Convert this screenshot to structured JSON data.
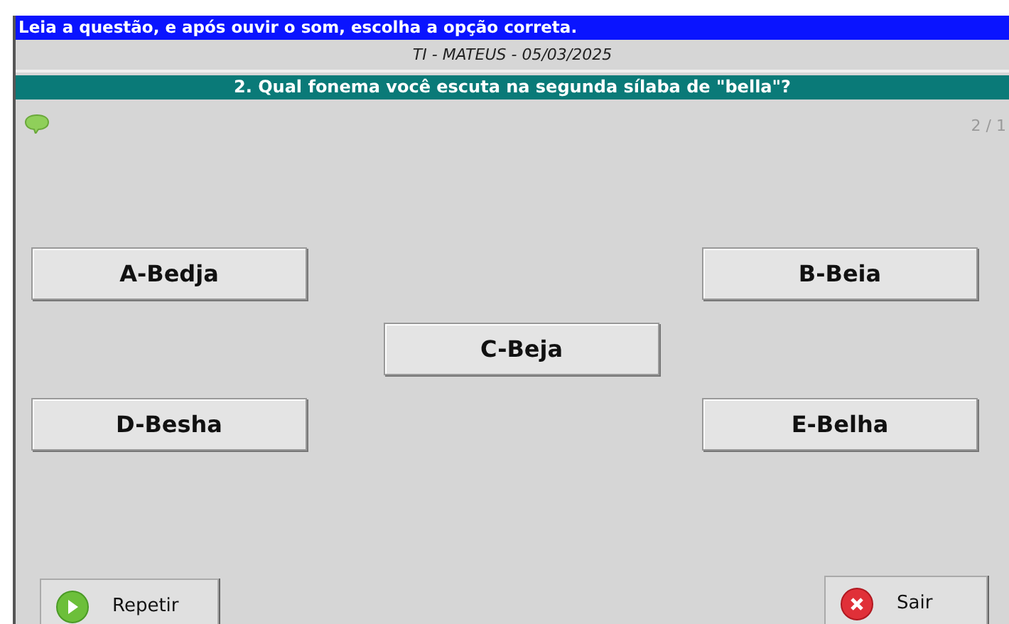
{
  "instruction": "Leia a questão, e após ouvir o som, escolha a opção correta.",
  "header": "TI - MATEUS - 05/03/2025",
  "question": "2. Qual fonema você escuta na segunda sílaba de \"bella\"?",
  "counter": "2 / 1",
  "options": [
    {
      "label": "A-Bedja"
    },
    {
      "label": "B-Beia"
    },
    {
      "label": "C-Beja"
    },
    {
      "label": "D-Besha"
    },
    {
      "label": "E-Belha"
    }
  ],
  "buttons": [
    {
      "kind": "repeat",
      "label": "Repetir"
    },
    {
      "kind": "exit",
      "label": "Sair"
    }
  ]
}
